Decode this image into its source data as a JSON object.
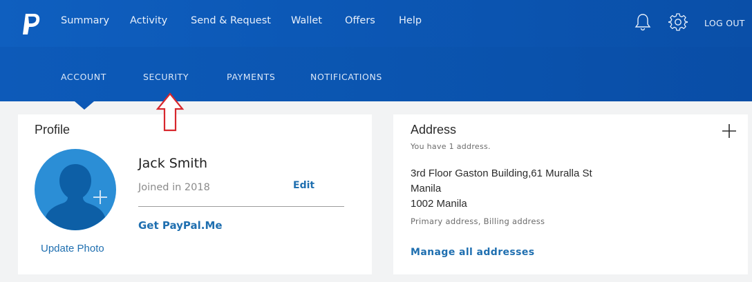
{
  "colors": {
    "brand_blue": "#0c58b6",
    "link_blue": "#1f6fb0",
    "annotation_red": "#d7262c",
    "avatar_blue": "#2b8ed6"
  },
  "header": {
    "nav_items": [
      "Summary",
      "Activity",
      "Send & Request",
      "Wallet",
      "Offers",
      "Help"
    ],
    "icons": [
      "notifications-bell-icon",
      "settings-gear-icon"
    ],
    "logout_label": "LOG OUT"
  },
  "subnav": {
    "items": [
      "ACCOUNT",
      "SECURITY",
      "PAYMENTS",
      "NOTIFICATIONS"
    ],
    "selected": "ACCOUNT"
  },
  "profile": {
    "title": "Profile",
    "name": "Jack Smith",
    "joined": "Joined in 2018",
    "edit_label": "Edit",
    "paypal_me_label": "Get PayPal.Me",
    "update_photo_label": "Update Photo"
  },
  "address": {
    "title": "Address",
    "subtitle": "You have 1 address.",
    "lines": [
      "3rd Floor Gaston Building,61 Muralla St",
      "Manila",
      "1002 Manila"
    ],
    "tags": "Primary address, Billing address",
    "manage_label": "Manage all addresses"
  }
}
